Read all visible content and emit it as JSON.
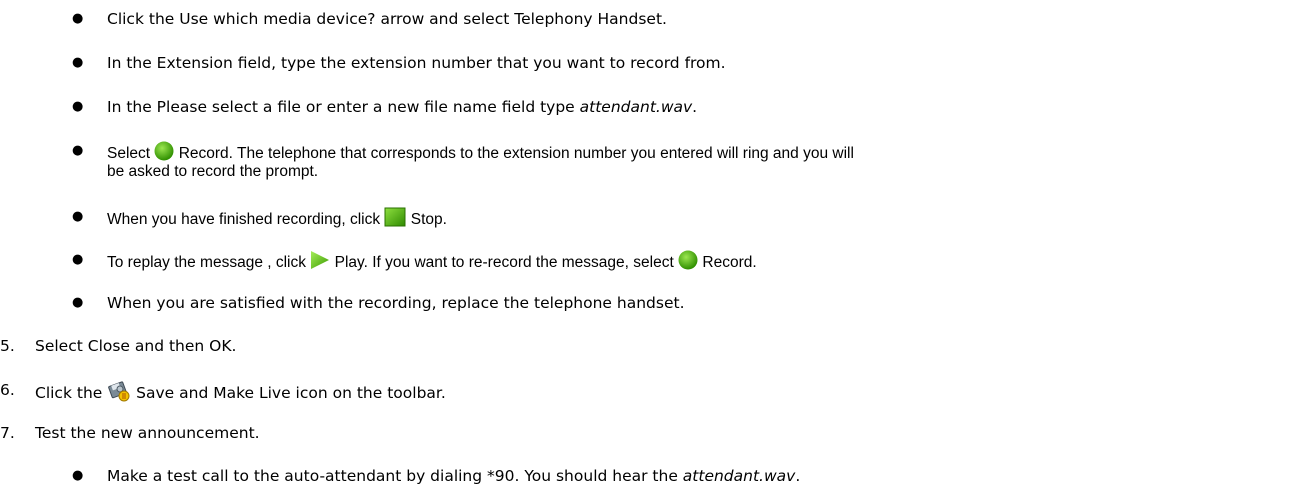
{
  "steps": {
    "bullets_a": [
      {
        "text": "Click the Use which media device? arrow and select Telephony Handset."
      },
      {
        "text": "In the Extension field, type the extension number that you want to record from."
      },
      {
        "text_before": "In the Please select a file or enter a new file name field type ",
        "em": "attendant.wav",
        "text_after": "."
      },
      {
        "text_before": "Select ",
        "text_after": " Record. The telephone that corresponds to the extension number you entered will ring and you will",
        "text_line2": "be asked to record the prompt."
      },
      {
        "text_before": "When you have finished recording, click ",
        "text_after": " Stop."
      },
      {
        "text_before": "To replay the message , click ",
        "text_mid": " Play. If you want to re-record the message, select ",
        "text_after": " Record."
      },
      {
        "text": "When you are satisfied with the recording, replace the telephone handset."
      }
    ],
    "numbered": [
      {
        "number": "5.",
        "text": "Select Close and then OK."
      },
      {
        "number": "6.",
        "text_before": "Click the ",
        "text_after": " Save and Make Live icon on the toolbar."
      },
      {
        "number": "7.",
        "text": "Test the new announcement."
      }
    ],
    "bullets_b": [
      {
        "text_before": "Make a test call to the auto-attendant by dialing *90. You should hear the ",
        "em": "attendant.wav",
        "text_after": "."
      }
    ]
  },
  "icons": {
    "record": "record-green-circle-icon",
    "stop": "stop-green-square-icon",
    "play": "play-green-triangle-icon",
    "save_live": "save-and-make-live-icon"
  },
  "colors": {
    "record_green": "#3fa800",
    "stop_green": "#4fb800",
    "play_green": "#5cc000"
  }
}
